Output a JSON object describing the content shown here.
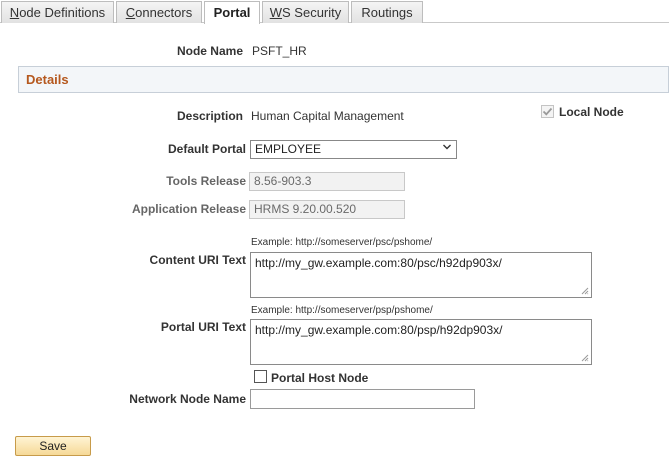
{
  "tabs": [
    {
      "label_ul": "N",
      "label_rest": "ode Definitions"
    },
    {
      "label_ul": "C",
      "label_rest": "onnectors"
    },
    {
      "label": "Portal"
    },
    {
      "label_ul": "W",
      "label_rest": "S Security"
    },
    {
      "label": "Routings"
    }
  ],
  "node": {
    "label": "Node Name",
    "value": "PSFT_HR"
  },
  "section": {
    "title": "Details"
  },
  "description": {
    "label": "Description",
    "value": "Human Capital Management"
  },
  "local_node": {
    "label": "Local Node",
    "checked": true
  },
  "default_portal": {
    "label": "Default Portal",
    "value": "EMPLOYEE"
  },
  "tools_release": {
    "label": "Tools Release",
    "value": "8.56-903.3"
  },
  "app_release": {
    "label": "Application Release",
    "value": "HRMS 9.20.00.520"
  },
  "content_uri": {
    "example": "Example: http://someserver/psc/pshome/",
    "label": "Content URI Text",
    "value": "http://my_gw.example.com:80/psc/h92dp903x/"
  },
  "portal_uri": {
    "example": "Example: http://someserver/psp/pshome/",
    "label": "Portal URI Text",
    "value": "http://my_gw.example.com:80/psp/h92dp903x/"
  },
  "portal_host_node": {
    "label": "Portal Host Node",
    "checked": false
  },
  "network_node": {
    "label": "Network Node Name",
    "value": ""
  },
  "save_label": "Save"
}
